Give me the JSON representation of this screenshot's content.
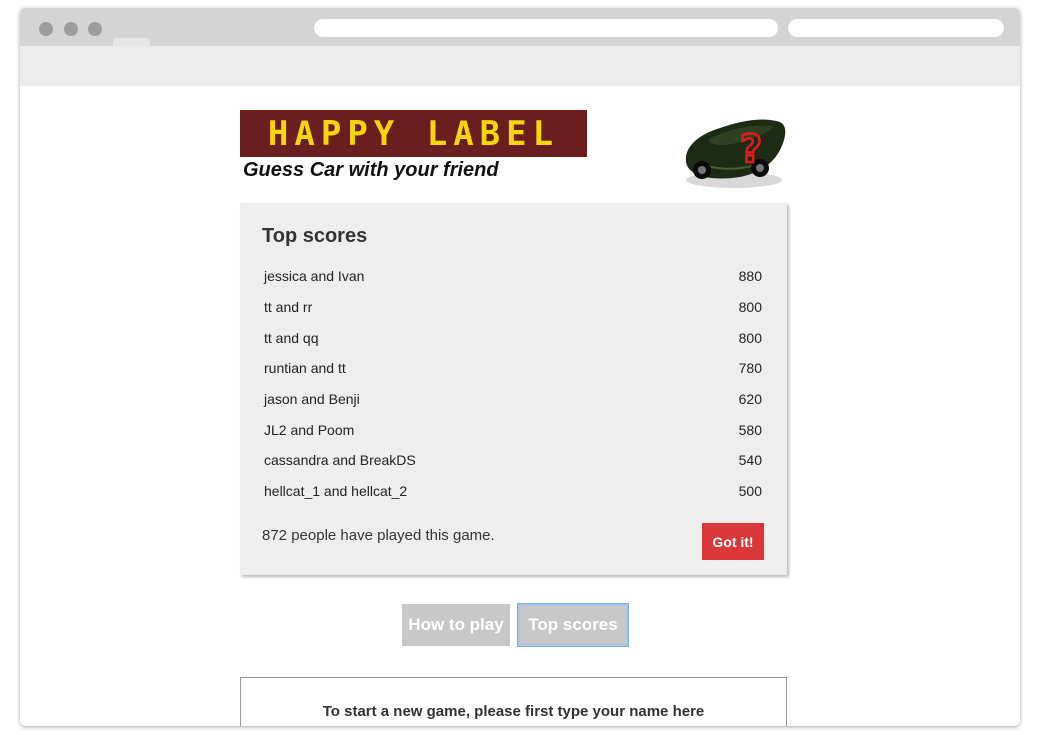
{
  "colors": {
    "logo_background": "#6b1e20",
    "logo_text": "#f5d60a",
    "got_it_button": "#d9373a",
    "tab_button": "#c8c8c8",
    "active_tab_outline": "#a7c6e8"
  },
  "header": {
    "logo_text": "HAPPY LABEL",
    "tagline": "Guess Car with your friend",
    "car_icon": "car-question-icon"
  },
  "modal": {
    "title": "Top scores",
    "scores": [
      {
        "names": "jessica and Ivan",
        "score": "880"
      },
      {
        "names": "tt and rr",
        "score": "800"
      },
      {
        "names": "tt and qq",
        "score": "800"
      },
      {
        "names": "runtian and tt",
        "score": "780"
      },
      {
        "names": "jason and Benji",
        "score": "620"
      },
      {
        "names": "JL2 and Poom",
        "score": "580"
      },
      {
        "names": "cassandra and BreakDS",
        "score": "540"
      },
      {
        "names": "hellcat_1 and hellcat_2",
        "score": "500"
      }
    ],
    "played_text": "872 people have played this game.",
    "got_it_label": "Got it!"
  },
  "tabs": {
    "how_to_play_label": "How to play",
    "top_scores_label": "Top scores",
    "active": "Top scores"
  },
  "start": {
    "prompt": "To start a new game, please first type your name here"
  }
}
